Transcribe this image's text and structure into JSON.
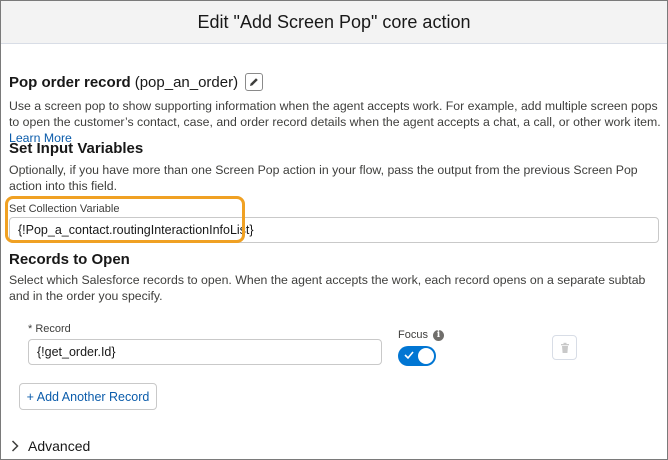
{
  "header": {
    "title": "Edit \"Add Screen Pop\" core action"
  },
  "action": {
    "label": "Pop order record",
    "api_name": "(pop_an_order)",
    "edit_icon": "pencil-icon"
  },
  "description": {
    "text": "Use a screen pop to show supporting information when the agent accepts work. For example, add multiple screen pops to open the customer’s contact, case, and order record details when the agent accepts a chat, a call, or other work item. ",
    "link": "Learn More"
  },
  "input_variables": {
    "title": "Set Input Variables",
    "help": "Optionally, if you have more than one Screen Pop action in your flow, pass the output from the previous Screen Pop action into this field.",
    "collection_label": "Set Collection Variable",
    "collection_value": "{!Pop_a_contact.routingInteractionInfoList}"
  },
  "records": {
    "title": "Records to Open",
    "help": "Select which Salesforce records to open. When the agent accepts the work, each record opens on a separate subtab and in the order you specify.",
    "record_label": "* Record",
    "record_value": "{!get_order.Id}",
    "focus_label": "Focus",
    "focus_on": true,
    "add_button": "+ Add Another Record"
  },
  "advanced": {
    "label": "Advanced"
  },
  "colors": {
    "brand": "#0176d3",
    "link": "#0b5cab",
    "highlight": "#f0a123"
  }
}
